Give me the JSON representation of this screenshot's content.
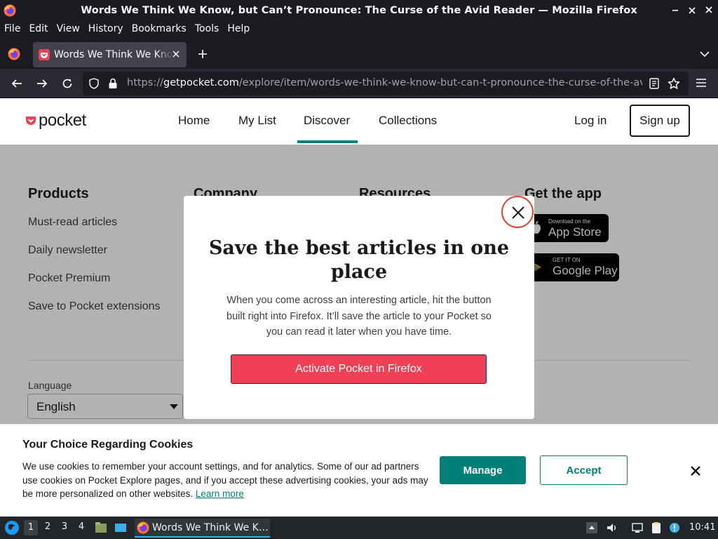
{
  "window": {
    "title": "Words We Think We Know, but Can’t Pronounce: The Curse of the Avid Reader — Mozilla Firefox"
  },
  "menu": [
    "File",
    "Edit",
    "View",
    "History",
    "Bookmarks",
    "Tools",
    "Help"
  ],
  "tab": {
    "title": "Words We Think We Know, but Can’t Pronounce"
  },
  "urlbar": {
    "scheme": "https://",
    "host": "getpocket.com",
    "path": "/explore/item/words-we-think-we-know-but-can-t-pronounce-the-curse-of-the-avid-reader"
  },
  "site": {
    "logo": "pocket",
    "nav": [
      "Home",
      "My List",
      "Discover",
      "Collections"
    ],
    "active_nav": "Discover",
    "login": "Log in",
    "signup": "Sign up"
  },
  "footer": {
    "columns": [
      {
        "title": "Products",
        "links": [
          "Must-read articles",
          "Daily newsletter",
          "Pocket Premium",
          "Save to Pocket extensions"
        ]
      },
      {
        "title": "Company",
        "links": []
      },
      {
        "title": "Resources",
        "links": []
      },
      {
        "title": "Get the app",
        "links": []
      }
    ],
    "app_store": {
      "small": "Download on the",
      "big": "App Store"
    },
    "google_play": {
      "small": "GET IT ON",
      "big": "Google Play"
    },
    "language_label": "Language",
    "language_value": "English"
  },
  "modal": {
    "title": "Save the best articles in one place",
    "body": "When you come across an interesting article, hit the button built right into Firefox. It’ll save the article to your Pocket so you can read it later when you have time.",
    "cta": "Activate Pocket in Firefox"
  },
  "cookie_banner": {
    "title": "Your Choice Regarding Cookies",
    "body": "We use cookies to remember your account settings, and for analytics. Some of our ad partners use cookies on Pocket Explore pages, and if you accept these advertising cookies, your ads may be more personalized on other websites.",
    "learn_more": "Learn more",
    "manage": "Manage",
    "accept": "Accept"
  },
  "taskbar": {
    "workspaces": [
      "1",
      "2",
      "3",
      "4"
    ],
    "active_workspace": "1",
    "task_label": "Words We Think We K…",
    "clock": "10:41"
  },
  "colors": {
    "pocket_red": "#ef4056",
    "teal": "#008078",
    "modal_close_ring": "#e0462f"
  }
}
